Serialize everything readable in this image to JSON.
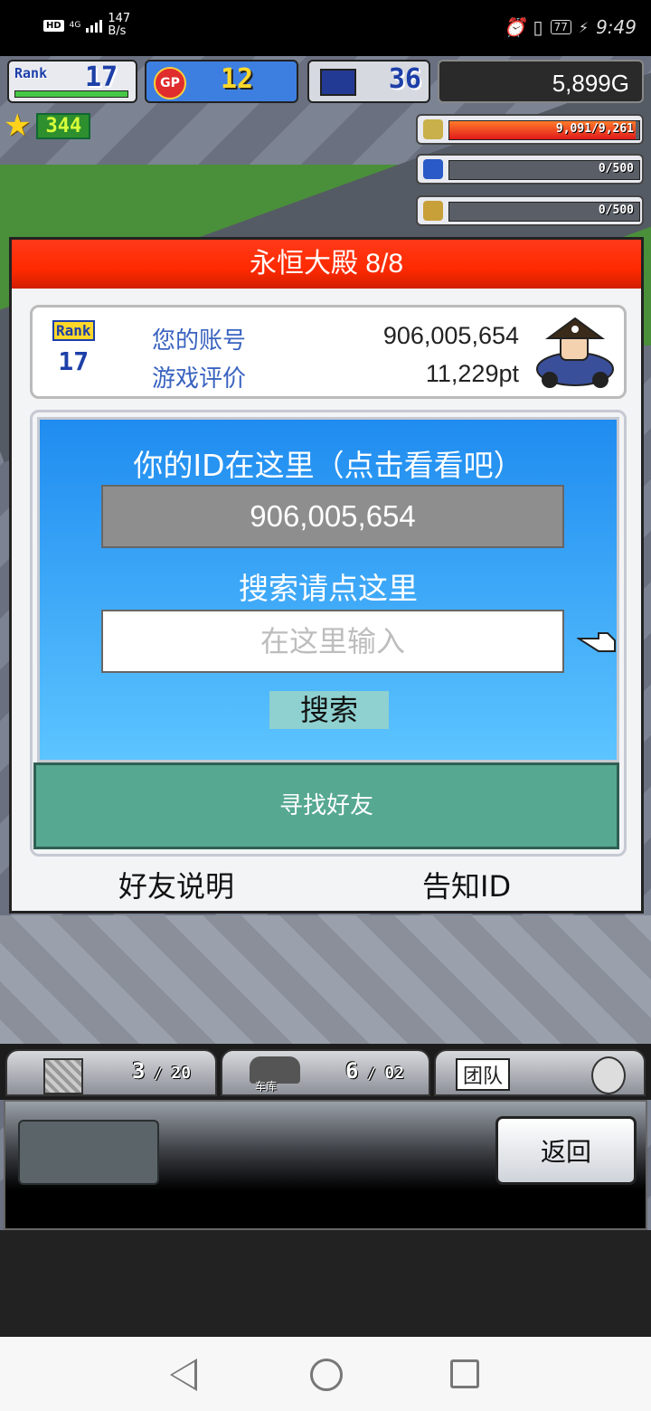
{
  "status_bar": {
    "network_label": "HD",
    "net_type": "4G",
    "speed_value": "147",
    "speed_unit": "B/s",
    "battery": "77",
    "time": "9:49"
  },
  "hud": {
    "rank_label": "Rank",
    "rank_value": "17",
    "gp_label": "GP",
    "gp_value": "12",
    "pc_value": "36",
    "money": "5,899G",
    "stars": "344"
  },
  "resources": [
    {
      "value_text": "9,091/9,261",
      "fill_fraction": 0.98,
      "icon": "coin-icon"
    },
    {
      "value_text": "0/500",
      "fill_fraction": 0,
      "icon": "bottle-icon"
    },
    {
      "value_text": "0/500",
      "fill_fraction": 0,
      "icon": "wheat-icon"
    }
  ],
  "dialog": {
    "title": "永恒大殿 8/8",
    "rank_label": "Rank",
    "rank_value": "17",
    "account_label": "您的账号",
    "account_value": "906,005,654",
    "rating_label": "游戏评价",
    "rating_value": "11,229pt",
    "id_heading": "你的ID在这里（点击看看吧）",
    "id_value": "906,005,654",
    "search_heading": "搜索请点这里",
    "search_placeholder": "在这里输入",
    "search_button": "搜索",
    "find_friend": "寻找好友",
    "friend_help": "好友说明",
    "tell_id": "告知ID"
  },
  "bottom_tabs": {
    "box_count": "3",
    "box_total": "20",
    "garage_label": "车库",
    "garage_count": "6",
    "garage_total": "02",
    "team_label": "团队"
  },
  "panel": {
    "back_button": "返回"
  },
  "colors": {
    "title_red": "#ff2a00",
    "panel_blue": "#1f8cf0",
    "friend_green": "#56a891"
  }
}
